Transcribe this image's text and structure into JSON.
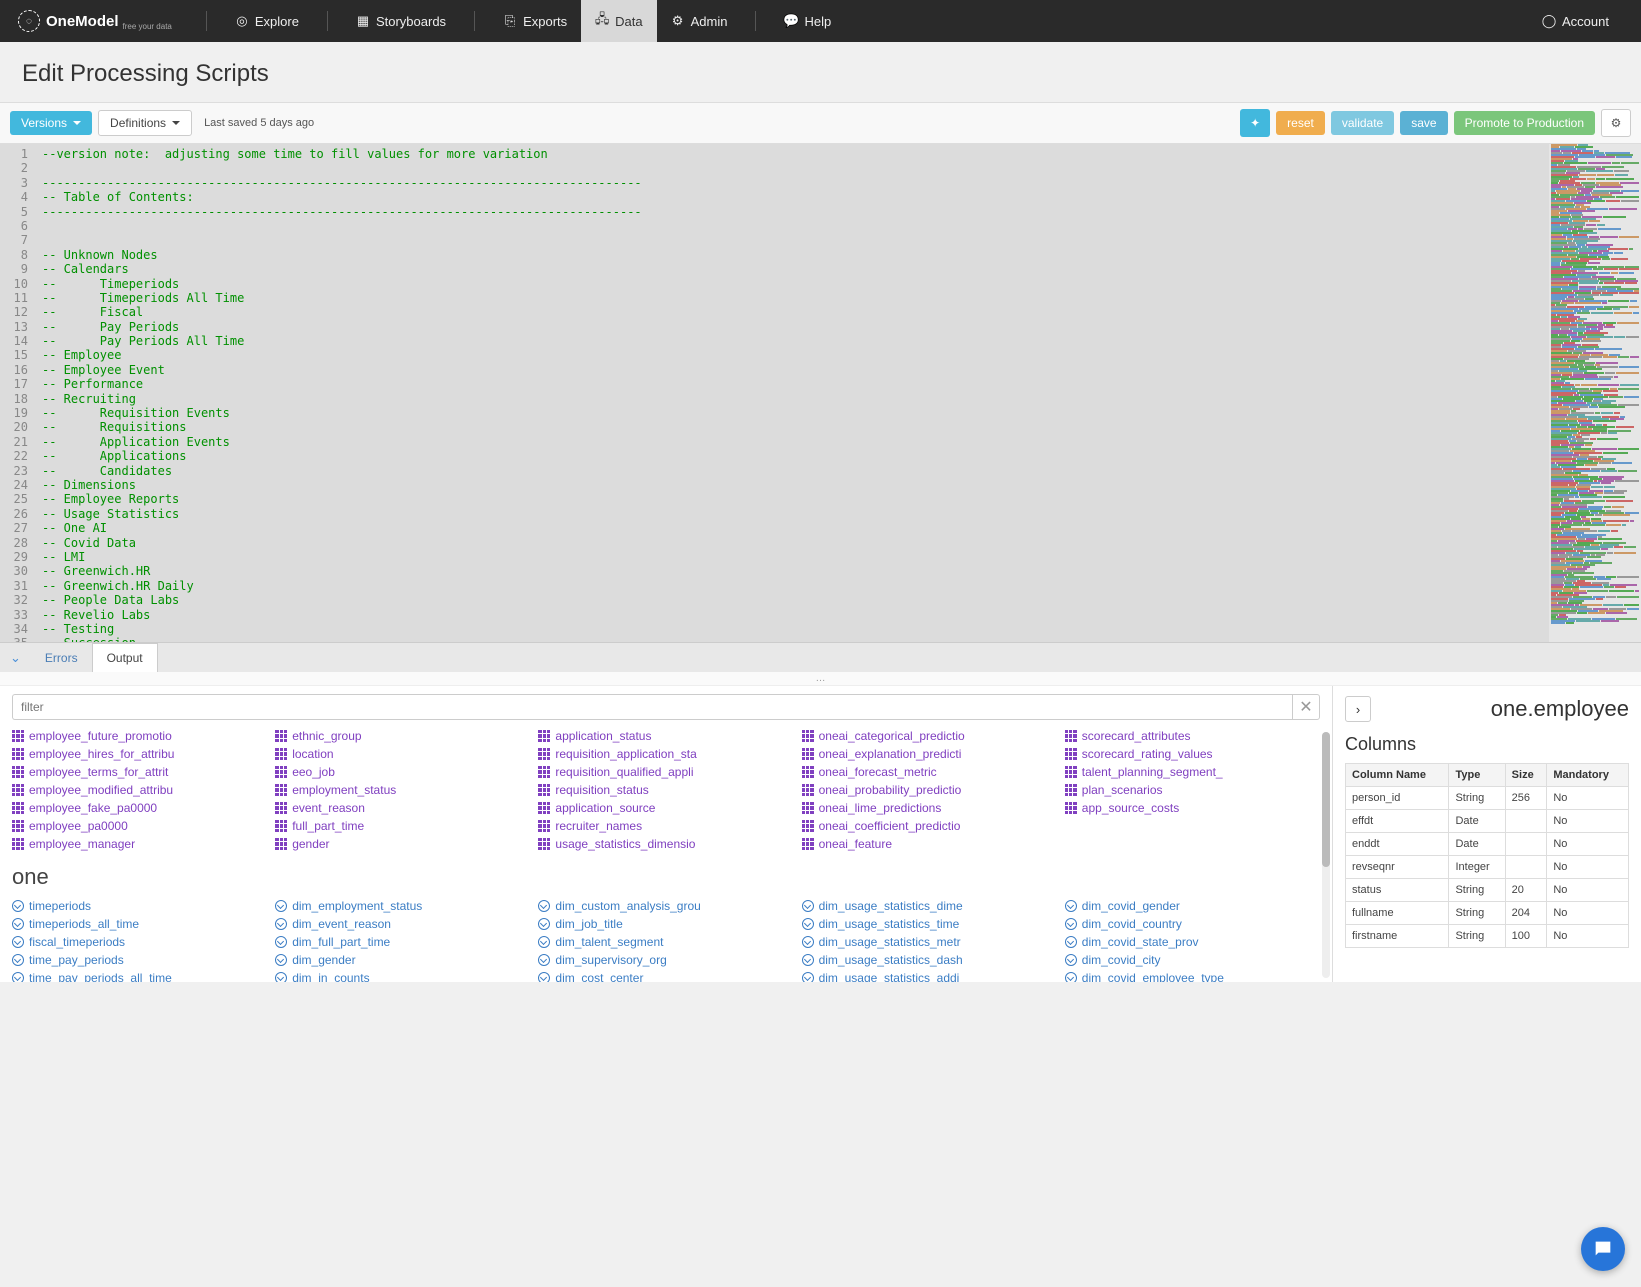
{
  "brand": {
    "name": "OneModel",
    "tagline": "free your data"
  },
  "nav": {
    "items": [
      {
        "label": "Explore",
        "icon": "compass-icon"
      },
      {
        "label": "Storyboards",
        "icon": "board-icon"
      },
      {
        "label": "Exports",
        "icon": "export-icon"
      },
      {
        "label": "Data",
        "icon": "data-icon",
        "active": true
      },
      {
        "label": "Admin",
        "icon": "gear-icon"
      },
      {
        "label": "Help",
        "icon": "help-icon"
      }
    ],
    "account_label": "Account"
  },
  "page_title": "Edit Processing Scripts",
  "toolbar": {
    "versions_label": "Versions",
    "definitions_label": "Definitions",
    "last_saved": "Last saved 5 days ago",
    "reset_label": "reset",
    "validate_label": "validate",
    "save_label": "save",
    "promote_label": "Promote to Production"
  },
  "editor": {
    "lines": [
      "--version note:  adjusting some time to fill values for more variation",
      "",
      "-----------------------------------------------------------------------------------",
      "-- Table of Contents:",
      "-----------------------------------------------------------------------------------",
      "",
      "",
      "-- Unknown Nodes",
      "-- Calendars",
      "--      Timeperiods",
      "--      Timeperiods All Time",
      "--      Fiscal",
      "--      Pay Periods",
      "--      Pay Periods All Time",
      "-- Employee",
      "-- Employee Event",
      "-- Performance",
      "-- Recruiting",
      "--      Requisition Events",
      "--      Requisitions",
      "--      Application Events",
      "--      Applications",
      "--      Candidates",
      "-- Dimensions",
      "-- Employee Reports",
      "-- Usage Statistics",
      "-- One AI",
      "-- Covid Data",
      "-- LMI",
      "-- Greenwich.HR",
      "-- Greenwich.HR Daily",
      "-- People Data Labs",
      "-- Revelio Labs",
      "-- Testing",
      "-- Succession"
    ]
  },
  "bottom_tabs": {
    "errors": "Errors",
    "output": "Output"
  },
  "filter": {
    "placeholder": "filter"
  },
  "purple_items": [
    [
      "employee_future_promotio",
      "employee_hires_for_attribu",
      "employee_terms_for_attrit",
      "employee_modified_attribu",
      "employee_fake_pa0000",
      "employee_pa0000",
      "employee_manager"
    ],
    [
      "ethnic_group",
      "location",
      "eeo_job",
      "employment_status",
      "event_reason",
      "full_part_time",
      "gender"
    ],
    [
      "application_status",
      "requisition_application_sta",
      "requisition_qualified_appli",
      "requisition_status",
      "application_source",
      "recruiter_names",
      "usage_statistics_dimensio"
    ],
    [
      "oneai_categorical_predictio",
      "oneai_explanation_predicti",
      "oneai_forecast_metric",
      "oneai_probability_predictio",
      "oneai_lime_predictions",
      "oneai_coefficient_predictio",
      "oneai_feature"
    ],
    [
      "scorecard_attributes",
      "scorecard_rating_values",
      "talent_planning_segment_",
      "plan_scenarios",
      "app_source_costs"
    ]
  ],
  "section_one_header": "one",
  "blue_items": [
    [
      "timeperiods",
      "timeperiods_all_time",
      "fiscal_timeperiods",
      "time_pay_periods",
      "time_pay_periods_all_time"
    ],
    [
      "dim_employment_status",
      "dim_event_reason",
      "dim_full_part_time",
      "dim_gender",
      "dim_in_counts"
    ],
    [
      "dim_custom_analysis_grou",
      "dim_job_title",
      "dim_talent_segment",
      "dim_supervisory_org",
      "dim_cost_center"
    ],
    [
      "dim_usage_statistics_dime",
      "dim_usage_statistics_time",
      "dim_usage_statistics_metr",
      "dim_usage_statistics_dash",
      "dim_usage_statistics_addi"
    ],
    [
      "dim_covid_gender",
      "dim_covid_country",
      "dim_covid_state_prov",
      "dim_covid_city",
      "dim_covid_employee_type"
    ]
  ],
  "right_panel": {
    "title": "one.employee",
    "columns_header": "Columns",
    "table_headers": [
      "Column Name",
      "Type",
      "Size",
      "Mandatory"
    ],
    "rows": [
      {
        "name": "person_id",
        "type": "String",
        "size": "256",
        "mandatory": "No"
      },
      {
        "name": "effdt",
        "type": "Date",
        "size": "",
        "mandatory": "No"
      },
      {
        "name": "enddt",
        "type": "Date",
        "size": "",
        "mandatory": "No"
      },
      {
        "name": "revseqnr",
        "type": "Integer",
        "size": "",
        "mandatory": "No"
      },
      {
        "name": "status",
        "type": "String",
        "size": "20",
        "mandatory": "No"
      },
      {
        "name": "fullname",
        "type": "String",
        "size": "204",
        "mandatory": "No"
      },
      {
        "name": "firstname",
        "type": "String",
        "size": "100",
        "mandatory": "No"
      }
    ]
  }
}
